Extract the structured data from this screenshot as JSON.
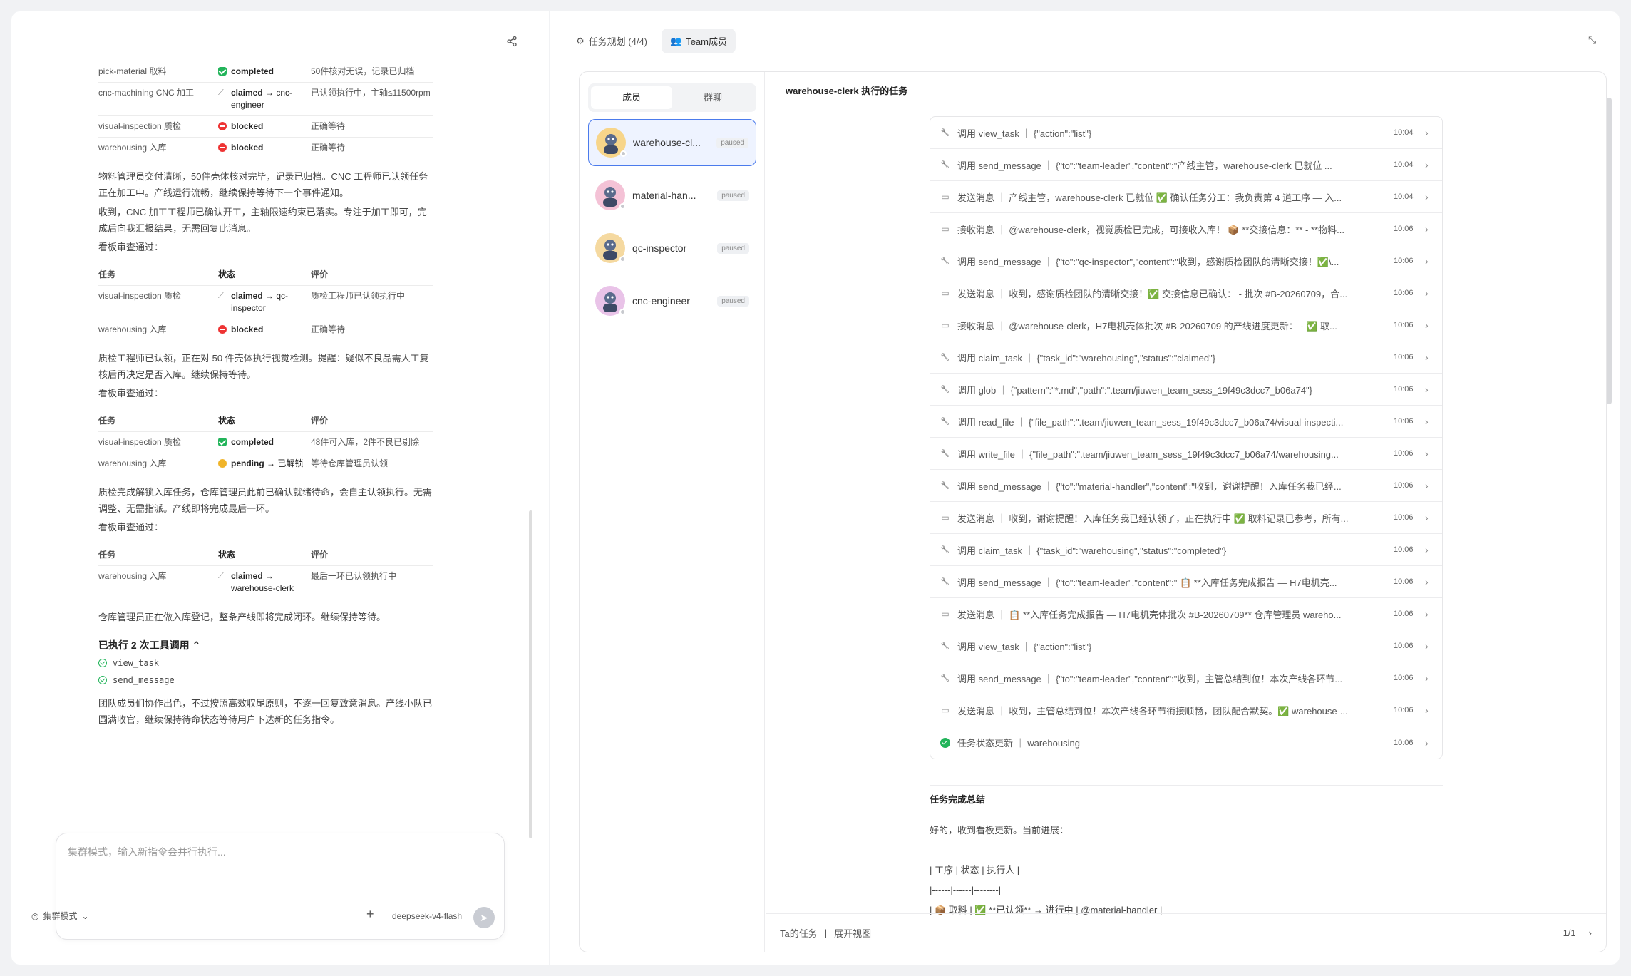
{
  "left": {
    "tables": [
      {
        "rows": [
          {
            "task": "pick-material 取料",
            "status": "completed",
            "status_kind": "done",
            "note": "50件核对无误，记录已归档"
          },
          {
            "task": "cnc-machining CNC 加工",
            "status": "claimed",
            "status_suffix": "→ cnc-engineer",
            "status_kind": "claimed",
            "note": "已认领执行中，主轴≤11500rpm"
          },
          {
            "task": "visual-inspection 质检",
            "status": "blocked",
            "status_kind": "blocked",
            "note": "正确等待"
          },
          {
            "task": "warehousing 入库",
            "status": "blocked",
            "status_kind": "blocked",
            "note": "正确等待"
          }
        ]
      }
    ],
    "para1": "物料管理员交付清晰，50件壳体核对完毕，记录已归档。CNC 工程师已认领任务正在加工中。产线运行流畅，继续保持等待下一个事件通知。",
    "para2": "收到，CNC 加工工程师已确认开工，主轴限速约束已落实。专注于加工即可，完成后向我汇报结果，无需回复此消息。",
    "pass1": "看板审查通过：",
    "t2": {
      "headers": [
        "任务",
        "状态",
        "评价"
      ],
      "rows": [
        {
          "task": "visual-inspection 质检",
          "status": "claimed",
          "status_suffix": "→ qc-inspector",
          "status_kind": "claimed",
          "note": "质检工程师已认领执行中"
        },
        {
          "task": "warehousing 入库",
          "status": "blocked",
          "status_kind": "blocked",
          "note": "正确等待"
        }
      ]
    },
    "para3": "质检工程师已认领，正在对 50 件壳体执行视觉检测。提醒：疑似不良品需人工复核后再决定是否入库。继续保持等待。",
    "pass2": "看板审查通过：",
    "t3": {
      "headers": [
        "任务",
        "状态",
        "评价"
      ],
      "rows": [
        {
          "task": "visual-inspection 质检",
          "status": "completed",
          "status_kind": "done",
          "note": "48件可入库，2件不良已剔除"
        },
        {
          "task": "warehousing 入库",
          "status": "pending",
          "status_suffix": "→ 已解锁",
          "status_kind": "pending",
          "note": "等待仓库管理员认领"
        }
      ]
    },
    "para4": "质检完成解锁入库任务，仓库管理员此前已确认就绪待命，会自主认领执行。无需调整、无需指派。产线即将完成最后一环。",
    "pass3": "看板审查通过：",
    "t4": {
      "headers": [
        "任务",
        "状态",
        "评价"
      ],
      "rows": [
        {
          "task": "warehousing 入库",
          "status": "claimed",
          "status_suffix": "→ warehouse-clerk",
          "status_kind": "claimed",
          "note": "最后一环已认领执行中"
        }
      ]
    },
    "para5": "仓库管理员正在做入库登记，整条产线即将完成闭环。继续保持等待。",
    "tools_header": "已执行 2 次工具调用 ⌃",
    "tools": [
      "view_task",
      "send_message"
    ],
    "para6": "团队成员们协作出色，不过按照高效収尾原则，不逐一回复致意消息。产线小队已圆满收官，继续保持待命状态等待用户下达新的任务指令。",
    "input_placeholder": "集群模式，输入新指令会并行执行...",
    "mode_label": "集群模式",
    "model_label": "deepseek-v4-flash"
  },
  "right": {
    "tabs": [
      {
        "label": "任务规划 (4/4)",
        "icon": "network-icon"
      },
      {
        "label": "Team成员",
        "icon": "users-icon"
      }
    ],
    "seg": [
      "成员",
      "群聊"
    ],
    "members": [
      {
        "name": "warehouse-clerk",
        "display": "warehouse-cl...",
        "badge": "paused",
        "color": "#f7d58a"
      },
      {
        "name": "material-handler",
        "display": "material-han...",
        "badge": "paused",
        "color": "#f4c2d6"
      },
      {
        "name": "qc-inspector",
        "display": "qc-inspector",
        "badge": "paused",
        "color": "#f5d9a0"
      },
      {
        "name": "cnc-engineer",
        "display": "cnc-engineer",
        "badge": "paused",
        "color": "#e9c3e8"
      }
    ],
    "detail_title": "warehouse-clerk 执行的任务",
    "events": [
      {
        "kind": "tool",
        "text": "调用 view_task ｜ {\"action\":\"list\"}",
        "time": "10:04"
      },
      {
        "kind": "tool",
        "text": "调用 send_message ｜ {\"to\":\"team-leader\",\"content\":\"产线主管，warehouse-clerk 已就位 ...",
        "time": "10:04"
      },
      {
        "kind": "msg",
        "text": "发送消息 ｜ 产线主管，warehouse-clerk 已就位 ✅ 确认任务分工：我负责第 4 道工序 — 入...",
        "time": "10:04"
      },
      {
        "kind": "msg",
        "text": "接收消息 ｜ @warehouse-clerk，视觉质检已完成，可接收入库！ 📦 **交接信息：** - **物料...",
        "time": "10:06"
      },
      {
        "kind": "tool",
        "text": "调用 send_message ｜ {\"to\":\"qc-inspector\",\"content\":\"收到，感谢质检团队的清晰交接！✅\\...",
        "time": "10:06"
      },
      {
        "kind": "msg",
        "text": "发送消息 ｜ 收到，感谢质检团队的清晰交接！✅ 交接信息已确认： - 批次 #B-20260709，合...",
        "time": "10:06"
      },
      {
        "kind": "msg",
        "text": "接收消息 ｜ @warehouse-clerk，H7电机壳体批次 #B-20260709 的产线进度更新： - ✅ 取...",
        "time": "10:06"
      },
      {
        "kind": "tool",
        "text": "调用 claim_task ｜ {\"task_id\":\"warehousing\",\"status\":\"claimed\"}",
        "time": "10:06"
      },
      {
        "kind": "tool",
        "text": "调用 glob ｜ {\"pattern\":\"*.md\",\"path\":\".team/jiuwen_team_sess_19f49c3dcc7_b06a74\"}",
        "time": "10:06"
      },
      {
        "kind": "tool",
        "text": "调用 read_file ｜ {\"file_path\":\".team/jiuwen_team_sess_19f49c3dcc7_b06a74/visual-inspecti...",
        "time": "10:06"
      },
      {
        "kind": "tool",
        "text": "调用 write_file ｜ {\"file_path\":\".team/jiuwen_team_sess_19f49c3dcc7_b06a74/warehousing...",
        "time": "10:06"
      },
      {
        "kind": "tool",
        "text": "调用 send_message ｜ {\"to\":\"material-handler\",\"content\":\"收到，谢谢提醒！入库任务我已经...",
        "time": "10:06"
      },
      {
        "kind": "msg",
        "text": "发送消息 ｜ 收到，谢谢提醒！入库任务我已经认领了，正在执行中 ✅ 取料记录已参考，所有...",
        "time": "10:06"
      },
      {
        "kind": "tool",
        "text": "调用 claim_task ｜ {\"task_id\":\"warehousing\",\"status\":\"completed\"}",
        "time": "10:06"
      },
      {
        "kind": "tool",
        "text": "调用 send_message ｜ {\"to\":\"team-leader\",\"content\":\" 📋 **入库任务完成报告 — H7电机壳...",
        "time": "10:06"
      },
      {
        "kind": "msg",
        "text": "发送消息 ｜ 📋 **入库任务完成报告 — H7电机壳体批次 #B-20260709** 仓库管理员 wareho...",
        "time": "10:06"
      },
      {
        "kind": "tool",
        "text": "调用 view_task ｜ {\"action\":\"list\"}",
        "time": "10:06"
      },
      {
        "kind": "tool",
        "text": "调用 send_message ｜ {\"to\":\"team-leader\",\"content\":\"收到，主管总结到位！本次产线各环节...",
        "time": "10:06"
      },
      {
        "kind": "msg",
        "text": "发送消息 ｜ 收到，主管总结到位！本次产线各环节衔接顺畅，团队配合默契。✅ warehouse-...",
        "time": "10:06"
      },
      {
        "kind": "status",
        "text": "任务状态更新 ｜ warehousing",
        "time": "10:06"
      }
    ],
    "summary_title": "任务完成总结",
    "summary_lines": [
      "好的，收到看板更新。当前进展：",
      "",
      "| 工序 | 状态 | 执行人 |",
      "|------|------|--------|",
      "| 📦 取料 | ✅ **已认领** → 进行中 | @material-handler |"
    ],
    "footer_left": "Ta的任务",
    "footer_sep": "|",
    "footer_expand": "展开视图",
    "footer_page": "1/1"
  }
}
